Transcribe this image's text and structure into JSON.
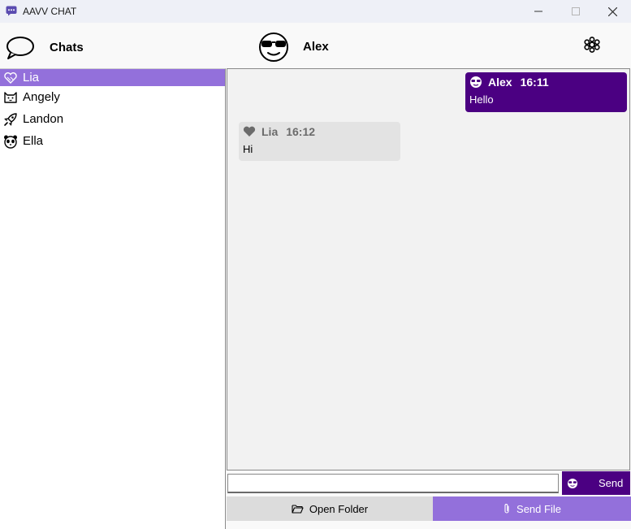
{
  "window": {
    "title": "AAVV CHAT",
    "controls": [
      "minimize-icon",
      "maximize-icon",
      "close-icon"
    ]
  },
  "header": {
    "chats_label": "Chats",
    "chats_icon": "speech-bubble-icon",
    "contact_name": "Alex",
    "contact_avatar": "sunglasses-face-icon",
    "settings_icon": "gear-icon"
  },
  "sidebar": {
    "items": [
      {
        "label": "Lia",
        "icon": "heart-icon",
        "selected": true
      },
      {
        "label": "Angely",
        "icon": "cat-face-icon",
        "selected": false
      },
      {
        "label": "Landon",
        "icon": "rocket-icon",
        "selected": false
      },
      {
        "label": "Ella",
        "icon": "panda-face-icon",
        "selected": false
      }
    ]
  },
  "messages": [
    {
      "sender": "Alex",
      "time": "16:11",
      "text": "Hello",
      "direction": "outgoing",
      "icon": "sunglasses-face-icon"
    },
    {
      "sender": "Lia",
      "time": "16:12",
      "text": "Hi",
      "direction": "incoming",
      "icon": "heart-icon"
    }
  ],
  "composer": {
    "value": "",
    "send_label": "Send",
    "send_icon": "sunglasses-face-icon"
  },
  "actions": {
    "open_folder_label": "Open Folder",
    "send_file_label": "Send File"
  },
  "colors": {
    "accent": "#9370db",
    "dark_accent": "#4b0082",
    "incoming_bubble": "#e3e3e3"
  }
}
